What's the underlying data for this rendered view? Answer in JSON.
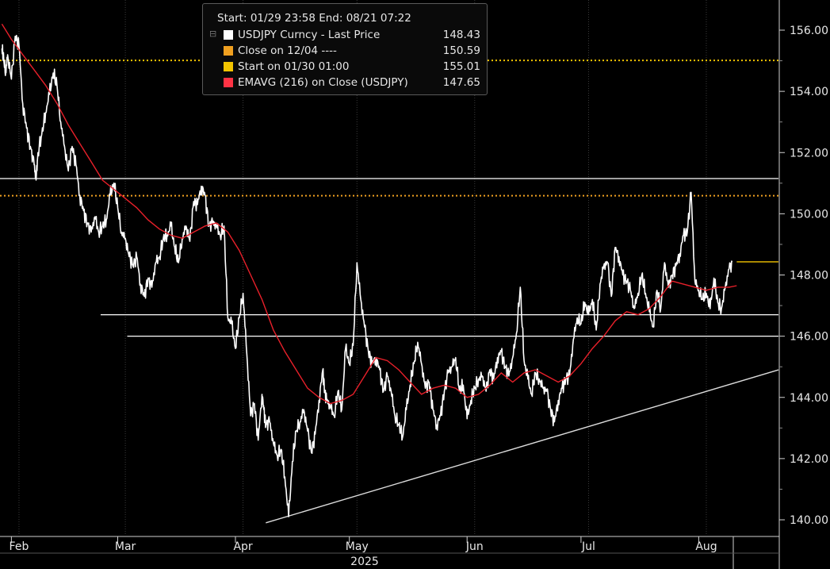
{
  "legend": {
    "header": "Start: 01/29 23:58 End: 08/21 07:22",
    "tree_glyph": "⊟",
    "items": [
      {
        "label": "USDJPY Curncy - Last Price",
        "value": "148.43",
        "color": "#ffffff"
      },
      {
        "label": "Close on 12/04 ----",
        "value": "150.59",
        "color": "#f0a020"
      },
      {
        "label": "Start on 01/30 01:00",
        "value": "155.01",
        "color": "#f2c400"
      },
      {
        "label": "EMAVG (216)  on Close (USDJPY)",
        "value": "147.65",
        "color": "#ff3344"
      }
    ]
  },
  "chart_data": {
    "type": "line",
    "title": "",
    "xlabel": "2025",
    "ylabel": "",
    "ylim": [
      139.2,
      157.2
    ],
    "y_ticks": [
      "140.00",
      "142.00",
      "144.00",
      "146.00",
      "148.00",
      "150.00",
      "152.00",
      "154.00",
      "156.00"
    ],
    "y_tick_values": [
      140,
      142,
      144,
      146,
      148,
      150,
      152,
      154,
      156
    ],
    "x_tick_labels": [
      "Feb",
      "Mar",
      "Apr",
      "May",
      "Jun",
      "Jul",
      "Aug"
    ],
    "x_range_days": [
      29,
      234
    ],
    "x_tick_days": [
      34,
      62,
      93,
      123,
      154,
      184,
      215
    ],
    "year_label": "2025",
    "colors": {
      "price": "#ffffff",
      "ema": "#e8202a",
      "start": "#f2c400",
      "close_ref": "#f0a020",
      "hlines": "#ffffff"
    },
    "series": [
      {
        "name": "USDJPY Curncy - Last Price",
        "day": [
          29.5,
          30,
          30.5,
          31,
          32,
          33,
          34,
          35,
          36,
          37,
          38,
          38.5,
          39,
          40,
          41,
          42,
          43,
          44,
          45,
          46,
          47,
          48,
          49,
          50,
          51,
          52,
          53,
          54,
          55,
          56,
          57,
          58,
          59,
          60,
          61,
          62,
          63,
          64,
          65,
          66,
          67,
          68,
          69,
          70,
          71,
          72,
          73,
          74,
          75,
          76,
          77,
          78,
          79,
          80,
          81,
          82,
          83,
          84,
          85,
          86,
          87,
          88,
          89,
          90,
          91,
          92,
          93,
          94,
          95,
          96,
          97,
          98,
          98.5,
          99,
          100,
          101,
          102,
          103,
          104,
          105,
          106,
          107,
          108,
          109,
          110,
          111,
          112,
          113,
          114,
          114.5,
          115,
          116,
          117,
          118,
          119,
          120,
          121,
          122,
          123,
          124,
          125,
          126,
          127,
          128,
          129,
          130,
          131,
          132,
          133,
          134,
          135,
          136,
          137,
          138,
          139,
          140,
          141,
          142,
          143,
          144,
          145,
          146,
          147,
          148,
          149,
          150,
          151,
          152,
          153,
          154,
          155,
          156,
          157,
          158,
          159,
          160,
          161,
          162,
          163,
          164,
          165,
          166,
          167,
          168,
          169,
          170,
          171,
          172,
          173,
          174,
          175,
          176,
          177,
          178,
          179,
          180,
          181,
          182,
          183,
          184,
          185,
          186,
          187,
          188,
          189,
          190,
          191,
          192,
          193,
          194,
          195,
          196,
          197,
          198,
          199,
          200,
          201,
          202,
          203,
          204,
          205,
          206,
          207,
          208,
          209,
          210,
          211,
          212,
          213,
          214,
          215,
          216,
          217,
          218,
          219,
          220,
          221,
          222,
          223
        ],
        "values": [
          155.4,
          155.0,
          154.6,
          155.2,
          154.4,
          155.8,
          155.5,
          153.6,
          152.8,
          152.2,
          151.6,
          151.1,
          152.0,
          152.6,
          153.3,
          153.9,
          154.6,
          154.2,
          153.0,
          152.2,
          151.4,
          152.2,
          151.6,
          150.6,
          150.1,
          149.7,
          149.4,
          149.9,
          149.4,
          149.6,
          149.8,
          150.6,
          151.0,
          150.2,
          149.4,
          149.2,
          148.6,
          148.3,
          148.6,
          147.7,
          147.3,
          147.9,
          147.6,
          148.4,
          148.6,
          149.2,
          149.3,
          149.6,
          148.9,
          148.4,
          149.2,
          149.6,
          149.1,
          150.4,
          150.3,
          150.9,
          150.6,
          149.6,
          149.7,
          149.6,
          149.3,
          149.6,
          146.6,
          146.4,
          145.6,
          146.6,
          147.4,
          145.4,
          143.4,
          143.8,
          142.6,
          144.1,
          143.6,
          143.1,
          143.2,
          142.5,
          142.1,
          142.3,
          141.4,
          140.1,
          141.9,
          142.9,
          143.2,
          143.6,
          142.9,
          142.2,
          142.8,
          143.9,
          144.9,
          144.2,
          143.9,
          143.7,
          143.4,
          144.2,
          143.6,
          145.6,
          145.1,
          145.7,
          148.4,
          147.2,
          146.3,
          145.5,
          145.1,
          145.3,
          144.9,
          144.2,
          144.7,
          144.2,
          143.4,
          143.1,
          142.7,
          143.6,
          144.4,
          145.1,
          145.8,
          145.1,
          144.3,
          144.5,
          143.6,
          143.1,
          143.4,
          144.2,
          144.8,
          145.0,
          145.3,
          144.2,
          144.4,
          143.3,
          143.9,
          144.3,
          144.6,
          144.7,
          144.2,
          144.9,
          144.6,
          145.3,
          145.5,
          145.0,
          144.7,
          145.3,
          146.1,
          147.6,
          145.2,
          144.6,
          144.1,
          144.8,
          144.6,
          144.3,
          144.2,
          143.6,
          143.2,
          143.9,
          144.3,
          144.6,
          144.7,
          145.9,
          146.6,
          146.4,
          147.1,
          146.7,
          147.2,
          146.2,
          147.7,
          148.3,
          148.4,
          147.3,
          148.9,
          148.6,
          148.0,
          147.8,
          147.5,
          146.9,
          147.4,
          148.0,
          147.4,
          146.8,
          146.3,
          147.5,
          146.9,
          148.4,
          147.6,
          148.0,
          148.3,
          148.7,
          149.3,
          149.4,
          150.7,
          147.8,
          147.5,
          147.2,
          147.4,
          146.9,
          147.9,
          147.1,
          146.9,
          147.6,
          148.2,
          148.43
        ]
      },
      {
        "name": "EMAVG (216)  on Close (USDJPY)",
        "day": [
          29.5,
          32,
          35,
          38,
          41,
          44,
          47,
          50,
          53,
          56,
          59,
          62,
          65,
          68,
          71,
          74,
          77,
          80,
          83,
          86,
          89,
          92,
          95,
          98,
          101,
          104,
          107,
          110,
          113,
          116,
          119,
          122,
          125,
          128,
          131,
          134,
          137,
          140,
          143,
          146,
          149,
          152,
          155,
          158,
          161,
          164,
          167,
          170,
          173,
          176,
          179,
          182,
          185,
          188,
          191,
          194,
          197,
          200,
          203,
          206,
          209,
          212,
          215,
          218,
          221,
          223
        ],
        "values": [
          156.2,
          155.7,
          155.2,
          154.7,
          154.2,
          153.6,
          152.9,
          152.3,
          151.7,
          151.1,
          150.8,
          150.5,
          150.2,
          149.8,
          149.5,
          149.3,
          149.2,
          149.4,
          149.6,
          149.7,
          149.4,
          148.8,
          148.0,
          147.2,
          146.2,
          145.5,
          144.9,
          144.3,
          144.0,
          143.8,
          143.9,
          144.1,
          144.7,
          145.3,
          145.2,
          144.9,
          144.5,
          144.1,
          144.3,
          144.4,
          144.3,
          144.0,
          144.1,
          144.4,
          144.8,
          144.5,
          144.8,
          144.9,
          144.7,
          144.5,
          144.7,
          145.1,
          145.6,
          146.0,
          146.5,
          146.8,
          146.7,
          146.9,
          147.3,
          147.8,
          147.7,
          147.6,
          147.5,
          147.6,
          147.6,
          147.65
        ]
      },
      {
        "name": "Start on 01/30 01:00",
        "values": [
          155.01
        ]
      },
      {
        "name": "Close on 12/04 ----",
        "values": [
          150.59
        ]
      }
    ],
    "horizontal_lines": [
      {
        "value": 151.15,
        "from_day": 29
      },
      {
        "value": 146.7,
        "from_day": 55.5
      },
      {
        "value": 146.0,
        "from_day": 62.5
      }
    ],
    "trendline": {
      "from": [
        99,
        139.9
      ],
      "to": [
        234,
        144.9
      ]
    },
    "last_price_marker": {
      "value": 148.43,
      "from_day": 223
    }
  }
}
